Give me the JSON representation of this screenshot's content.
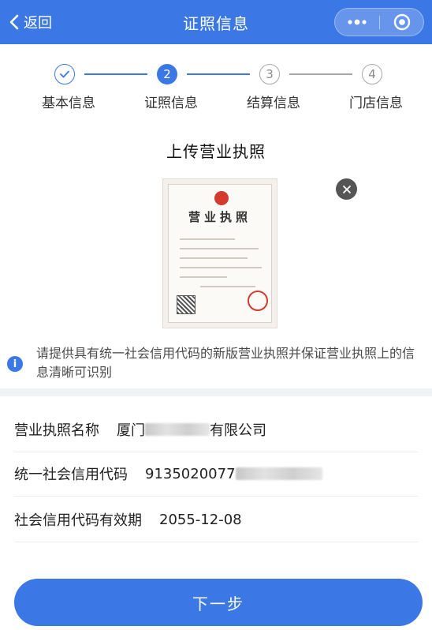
{
  "header": {
    "back_label": "返回",
    "title": "证照信息",
    "color": "#3b78e6"
  },
  "stepper": {
    "steps": [
      {
        "number": "1",
        "label": "基本信息",
        "state": "done"
      },
      {
        "number": "2",
        "label": "证照信息",
        "state": "active"
      },
      {
        "number": "3",
        "label": "结算信息",
        "state": "todo"
      },
      {
        "number": "4",
        "label": "门店信息",
        "state": "todo"
      }
    ]
  },
  "upload": {
    "title": "上传营业执照",
    "license_title": "营业执照"
  },
  "notice": "请提供具有统一社会信用代码的新版营业执照并保证营业执照上的信息清晰可识别",
  "fields": [
    {
      "label": "营业执照名称",
      "value_prefix": "厦门",
      "value_suffix": "有限公司"
    },
    {
      "label": "统一社会信用代码",
      "value_prefix": "9135020077",
      "value_suffix": ""
    },
    {
      "label": "社会信用代码有效期",
      "value_prefix": "2055-12-08",
      "value_suffix": ""
    }
  ],
  "next_button": "下一步"
}
